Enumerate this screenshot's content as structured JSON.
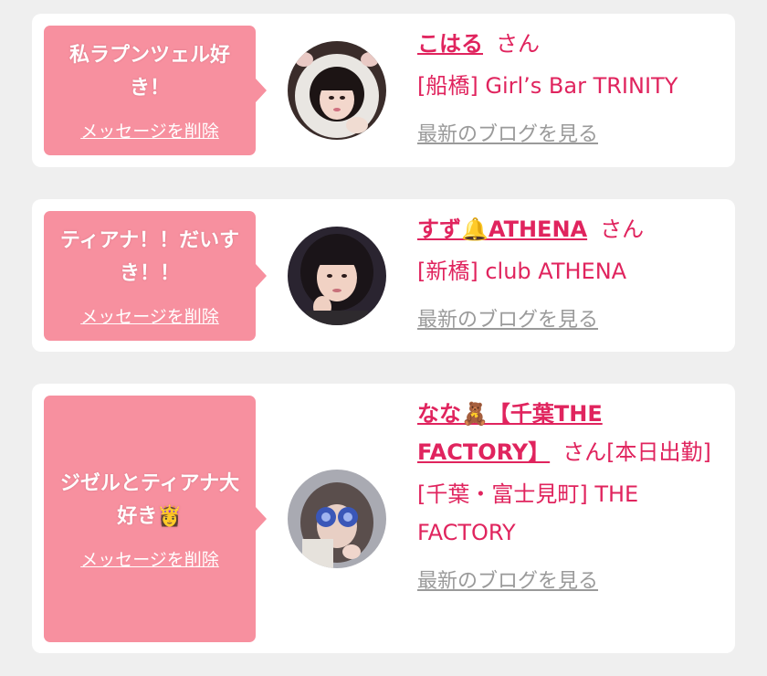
{
  "messages": [
    {
      "message": "私ラプンツェル好き！",
      "delete_label": "メッセージを削除",
      "name": "こはる",
      "honorific": "さん",
      "shop": "[船橋] Girl’s Bar TRINITY",
      "blog_label": "最新のブログを見る"
    },
    {
      "message": "ティアナ！！だいすき！！",
      "delete_label": "メッセージを削除",
      "name": "すず🔔ATHENA",
      "honorific": "さん",
      "shop": "[新橋] club ATHENA",
      "blog_label": "最新のブログを見る"
    },
    {
      "message": "ジゼルとティアナ大好き👸",
      "delete_label": "メッセージを削除",
      "name": "なな🧸【千葉THE FACTORY】",
      "honorific": "さん",
      "status": "[本日出勤]",
      "shop": "[千葉・富士見町] THE FACTORY",
      "blog_label": "最新のブログを見る"
    }
  ],
  "colors": {
    "background": "#efefef",
    "card": "#ffffff",
    "bubble": "#f7909f",
    "accent": "#e0245e",
    "link_gray": "#9a9a9a"
  }
}
